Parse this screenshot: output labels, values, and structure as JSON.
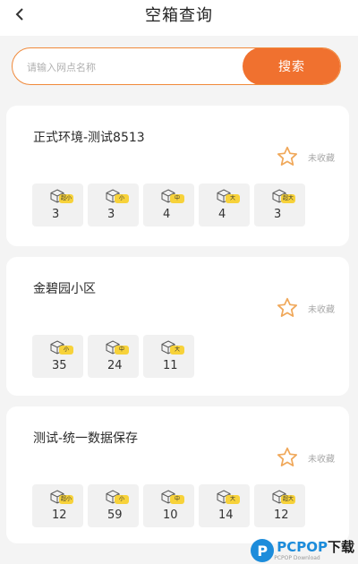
{
  "header": {
    "title": "空箱查询",
    "back_icon": "chevron-left-icon"
  },
  "search": {
    "placeholder": "请输入网点名称",
    "value": "",
    "button_label": "搜索"
  },
  "colors": {
    "accent": "#f0712f",
    "badge": "#f7d23a",
    "star": "#f0a85a"
  },
  "stations": [
    {
      "name": "正式环境-测试8513",
      "favorite_label": "未收藏",
      "boxes": [
        {
          "size": "超小",
          "count": "3"
        },
        {
          "size": "小",
          "count": "3"
        },
        {
          "size": "中",
          "count": "4"
        },
        {
          "size": "大",
          "count": "4"
        },
        {
          "size": "超大",
          "count": "3"
        }
      ]
    },
    {
      "name": "金碧园小区",
      "favorite_label": "未收藏",
      "boxes": [
        {
          "size": "小",
          "count": "35"
        },
        {
          "size": "中",
          "count": "24"
        },
        {
          "size": "大",
          "count": "11"
        }
      ]
    },
    {
      "name": "测试-统一数据保存",
      "favorite_label": "未收藏",
      "boxes": [
        {
          "size": "超小",
          "count": "12"
        },
        {
          "size": "小",
          "count": "59"
        },
        {
          "size": "中",
          "count": "10"
        },
        {
          "size": "大",
          "count": "14"
        },
        {
          "size": "超大",
          "count": "12"
        }
      ]
    }
  ],
  "watermark": {
    "text_main": "PCPOP",
    "text_suffix": "下载",
    "sub": "PCPOP Download"
  }
}
